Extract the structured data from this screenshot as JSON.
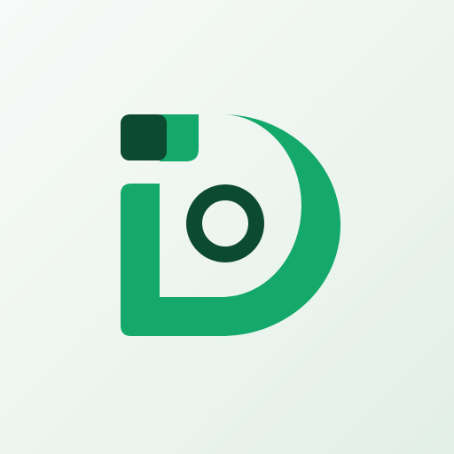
{
  "app_icon": {
    "name": "iD logo",
    "icon": "id-logo-icon",
    "colors": {
      "background_light": "#f7faf8",
      "background_dark": "#e2efe6",
      "brand_green": "#14a86a",
      "dark_green": "#0d4a32"
    }
  }
}
